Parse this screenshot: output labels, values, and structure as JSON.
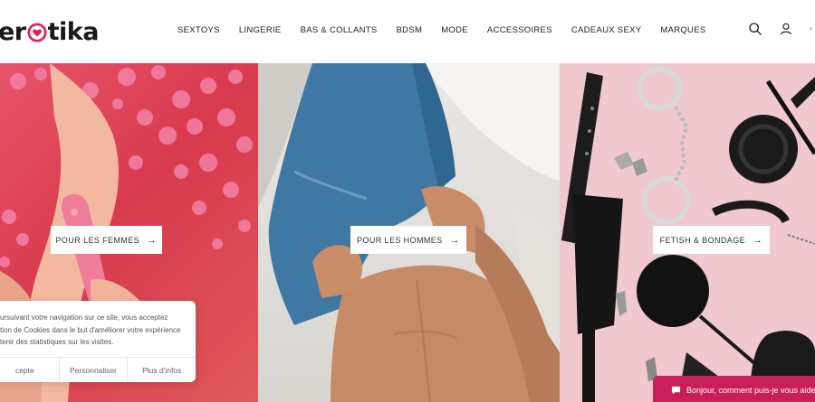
{
  "brand": {
    "logo_text_left": "er",
    "logo_text_right": "tika",
    "accent": "#e0264f"
  },
  "nav": [
    "SEXTOYS",
    "LINGERIE",
    "BAS & COLLANTS",
    "BDSM",
    "MODE",
    "ACCESSOIRES",
    "CADEAUX SEXY",
    "MARQUES"
  ],
  "icons": {
    "search": "search-icon",
    "account": "user-icon",
    "cart": "cart-icon"
  },
  "panels": {
    "women": {
      "cta": "POUR LES FEMMES"
    },
    "men": {
      "cta": "POUR LES HOMMES"
    },
    "fetish": {
      "cta": "FETISH & BONDAGE"
    }
  },
  "cookie": {
    "text_lines": [
      "ursuivant votre navigation sur ce site, vous acceptez",
      "tion de Cookies dans le but d'améliorer votre expérience",
      "tenir des statistiques sur les visites."
    ],
    "buttons": [
      "cepte",
      "Personnaliser",
      "Plus d'infos"
    ]
  },
  "chat": {
    "label": "Bonjour, comment puis-je vous aide"
  }
}
